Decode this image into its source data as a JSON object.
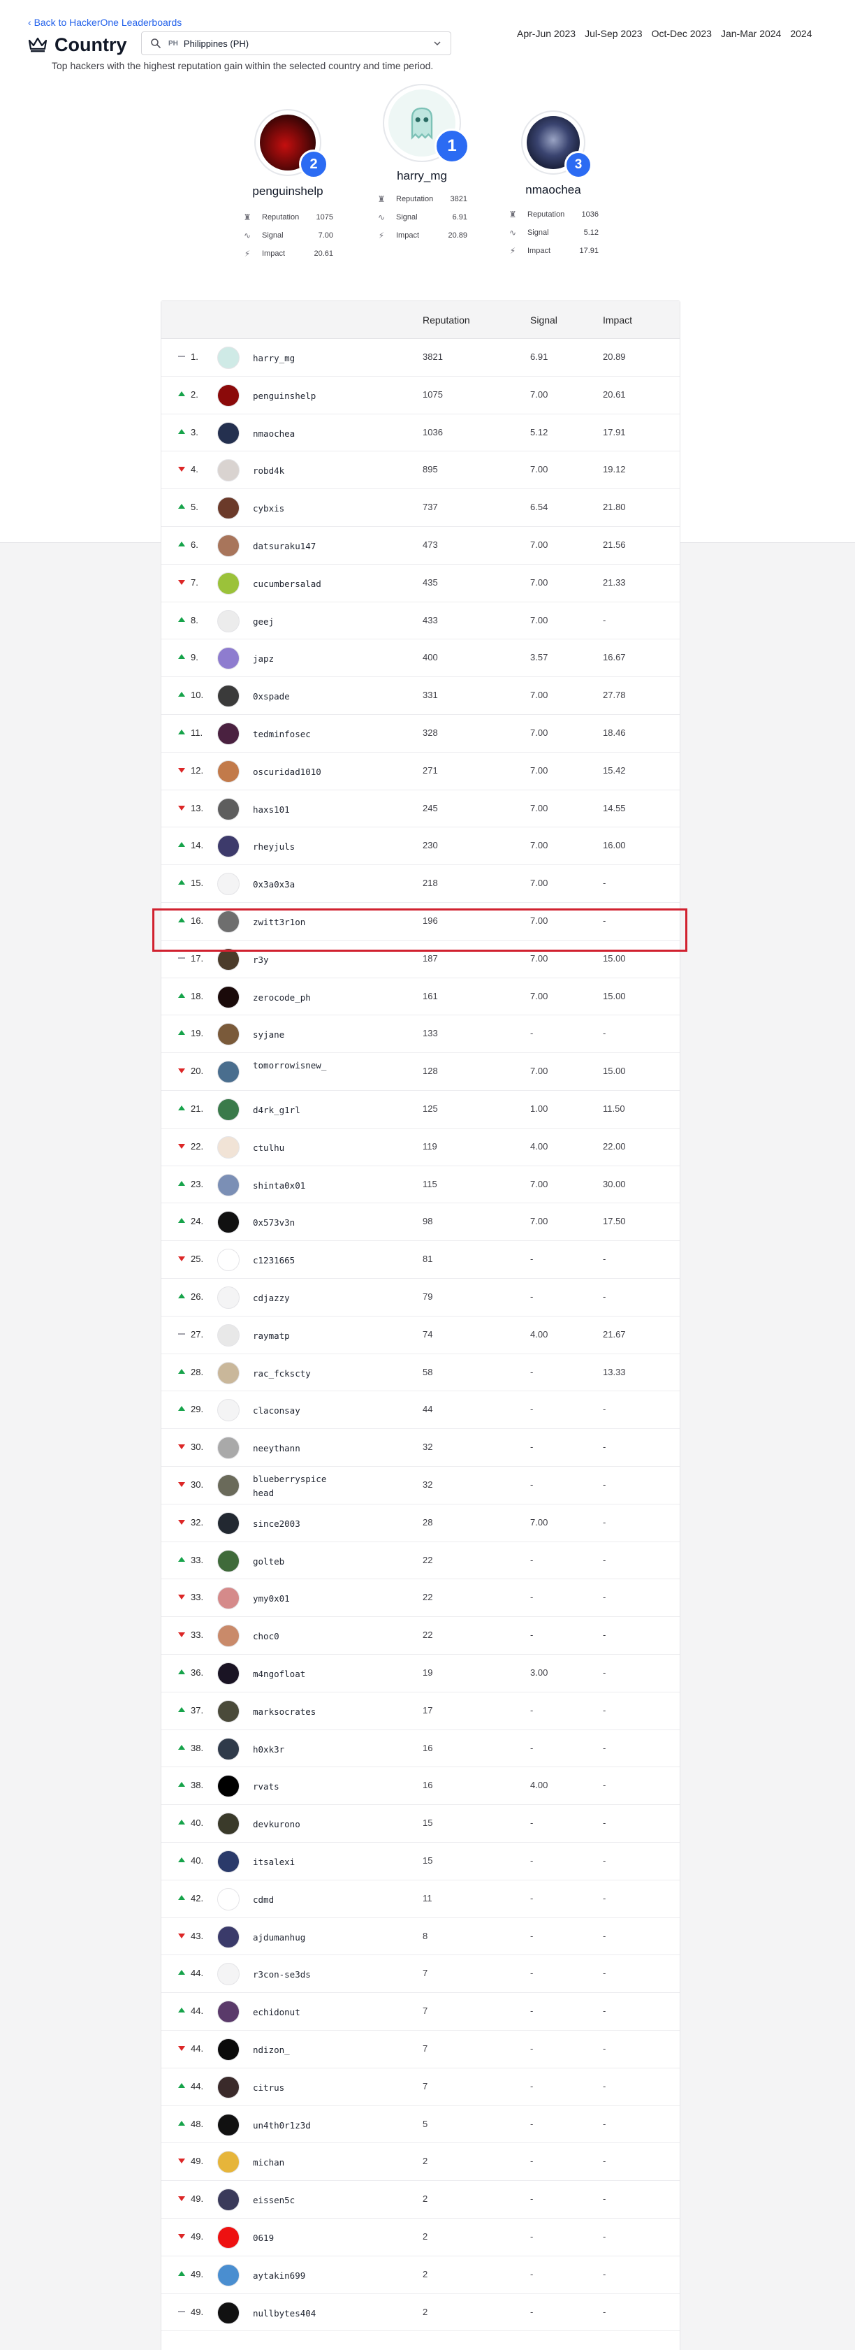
{
  "nav": {
    "back_label": "Back to HackerOne Leaderboards"
  },
  "header": {
    "title": "Country",
    "country_code": "PH",
    "country_value": "Philippines (PH)",
    "subtitle": "Top hackers with the highest reputation gain within the selected country and time period."
  },
  "periods": [
    "Apr-Jun 2023",
    "Jul-Sep 2023",
    "Oct-Dec 2023",
    "Jan-Mar 2024",
    "2024"
  ],
  "podium": [
    {
      "place": "1",
      "name": "harry_mg",
      "reputation": "3821",
      "signal": "6.91",
      "impact": "20.89",
      "avatar_color": "#e8f4f2",
      "avatar_icon": "ghost-icon"
    },
    {
      "place": "2",
      "name": "penguinshelp",
      "reputation": "1075",
      "signal": "7.00",
      "impact": "20.61",
      "avatar_color": "#8b0a0a",
      "avatar_icon": "red-dark-avatar"
    },
    {
      "place": "3",
      "name": "nmaochea",
      "reputation": "1036",
      "signal": "5.12",
      "impact": "17.91",
      "avatar_color": "#1e2a48",
      "avatar_icon": "masked-figure-avatar"
    }
  ],
  "stat_labels": {
    "reputation": "Reputation",
    "signal": "Signal",
    "impact": "Impact"
  },
  "table": {
    "headers": {
      "reputation": "Reputation",
      "signal": "Signal",
      "impact": "Impact"
    },
    "rows": [
      {
        "trend": "same",
        "rank": "1.",
        "name": "harry_mg",
        "rep": "3821",
        "sig": "6.91",
        "imp": "20.89",
        "color": "#cfeae6"
      },
      {
        "trend": "up",
        "rank": "2.",
        "name": "penguinshelp",
        "rep": "1075",
        "sig": "7.00",
        "imp": "20.61",
        "color": "#8b0a0a"
      },
      {
        "trend": "up",
        "rank": "3.",
        "name": "nmaochea",
        "rep": "1036",
        "sig": "5.12",
        "imp": "17.91",
        "color": "#24304f"
      },
      {
        "trend": "down",
        "rank": "4.",
        "name": "robd4k",
        "rep": "895",
        "sig": "7.00",
        "imp": "19.12",
        "color": "#d9d3d0"
      },
      {
        "trend": "up",
        "rank": "5.",
        "name": "cybxis",
        "rep": "737",
        "sig": "6.54",
        "imp": "21.80",
        "color": "#6b3a2a"
      },
      {
        "trend": "up",
        "rank": "6.",
        "name": "datsuraku147",
        "rep": "473",
        "sig": "7.00",
        "imp": "21.56",
        "color": "#a8755b"
      },
      {
        "trend": "down",
        "rank": "7.",
        "name": "cucumbersalad",
        "rep": "435",
        "sig": "7.00",
        "imp": "21.33",
        "color": "#9bc23a"
      },
      {
        "trend": "up",
        "rank": "8.",
        "name": "geej",
        "rep": "433",
        "sig": "7.00",
        "imp": "-",
        "color": "#ececec"
      },
      {
        "trend": "up",
        "rank": "9.",
        "name": "japz",
        "rep": "400",
        "sig": "3.57",
        "imp": "16.67",
        "color": "#8e7ccf"
      },
      {
        "trend": "up",
        "rank": "10.",
        "name": "0xspade",
        "rep": "331",
        "sig": "7.00",
        "imp": "27.78",
        "color": "#3a3a3a"
      },
      {
        "trend": "up",
        "rank": "11.",
        "name": "tedminfosec",
        "rep": "328",
        "sig": "7.00",
        "imp": "18.46",
        "color": "#4a2140"
      },
      {
        "trend": "down",
        "rank": "12.",
        "name": "oscuridad1010",
        "rep": "271",
        "sig": "7.00",
        "imp": "15.42",
        "color": "#c27a4a"
      },
      {
        "trend": "down",
        "rank": "13.",
        "name": "haxs101",
        "rep": "245",
        "sig": "7.00",
        "imp": "14.55",
        "color": "#5e5e5e"
      },
      {
        "trend": "up",
        "rank": "14.",
        "name": "rheyjuls",
        "rep": "230",
        "sig": "7.00",
        "imp": "16.00",
        "color": "#3d3a6b"
      },
      {
        "trend": "up",
        "rank": "15.",
        "name": "0x3a0x3a",
        "rep": "218",
        "sig": "7.00",
        "imp": "-",
        "color": "#f4f4f5"
      },
      {
        "trend": "up",
        "rank": "16.",
        "name": "zwitt3r1on",
        "rep": "196",
        "sig": "7.00",
        "imp": "-",
        "color": "#6e6e6e"
      },
      {
        "trend": "same",
        "rank": "17.",
        "name": "r3y",
        "rep": "187",
        "sig": "7.00",
        "imp": "15.00",
        "color": "#4b3b2a"
      },
      {
        "trend": "up",
        "rank": "18.",
        "name": "zerocode_ph",
        "rep": "161",
        "sig": "7.00",
        "imp": "15.00",
        "color": "#1a0a0a"
      },
      {
        "trend": "up",
        "rank": "19.",
        "name": "syjane",
        "rep": "133",
        "sig": "-",
        "imp": "-",
        "color": "#7a5a3a"
      },
      {
        "trend": "down",
        "rank": "20.",
        "name": "tomorrowisnew_",
        "rep": "128",
        "sig": "7.00",
        "imp": "15.00",
        "color": "#4a6e8e"
      },
      {
        "trend": "up",
        "rank": "21.",
        "name": "d4rk_g1rl",
        "rep": "125",
        "sig": "1.00",
        "imp": "11.50",
        "color": "#3a7a4a"
      },
      {
        "trend": "down",
        "rank": "22.",
        "name": "ctulhu",
        "rep": "119",
        "sig": "4.00",
        "imp": "22.00",
        "color": "#f1e3d6"
      },
      {
        "trend": "up",
        "rank": "23.",
        "name": "shinta0x01",
        "rep": "115",
        "sig": "7.00",
        "imp": "30.00",
        "color": "#7b8fb5"
      },
      {
        "trend": "up",
        "rank": "24.",
        "name": "0x573v3n",
        "rep": "98",
        "sig": "7.00",
        "imp": "17.50",
        "color": "#111111"
      },
      {
        "trend": "down",
        "rank": "25.",
        "name": "c1231665",
        "rep": "81",
        "sig": "-",
        "imp": "-",
        "color": "#ffffff"
      },
      {
        "trend": "up",
        "rank": "26.",
        "name": "cdjazzy",
        "rep": "79",
        "sig": "-",
        "imp": "-",
        "color": "#f4f4f5"
      },
      {
        "trend": "same",
        "rank": "27.",
        "name": "raymatp",
        "rep": "74",
        "sig": "4.00",
        "imp": "21.67",
        "color": "#e8e8e8"
      },
      {
        "trend": "up",
        "rank": "28.",
        "name": "rac_fckscty",
        "rep": "58",
        "sig": "-",
        "imp": "13.33",
        "color": "#c9b79a"
      },
      {
        "trend": "up",
        "rank": "29.",
        "name": "claconsay",
        "rep": "44",
        "sig": "-",
        "imp": "-",
        "color": "#f4f4f5"
      },
      {
        "trend": "down",
        "rank": "30.",
        "name": "neeythann",
        "rep": "32",
        "sig": "-",
        "imp": "-",
        "color": "#a9a9a9"
      },
      {
        "trend": "down",
        "rank": "30.",
        "name": "blueberryspicehead",
        "rep": "32",
        "sig": "-",
        "imp": "-",
        "color": "#6a6a5a"
      },
      {
        "trend": "down",
        "rank": "32.",
        "name": "since2003",
        "rep": "28",
        "sig": "7.00",
        "imp": "-",
        "color": "#222831"
      },
      {
        "trend": "up",
        "rank": "33.",
        "name": "golteb",
        "rep": "22",
        "sig": "-",
        "imp": "-",
        "color": "#3f6a3a"
      },
      {
        "trend": "down",
        "rank": "33.",
        "name": "ymy0x01",
        "rep": "22",
        "sig": "-",
        "imp": "-",
        "color": "#d58a8a"
      },
      {
        "trend": "down",
        "rank": "33.",
        "name": "choc0",
        "rep": "22",
        "sig": "-",
        "imp": "-",
        "color": "#c98a6a"
      },
      {
        "trend": "up",
        "rank": "36.",
        "name": "m4ngofloat",
        "rep": "19",
        "sig": "3.00",
        "imp": "-",
        "color": "#1a1424"
      },
      {
        "trend": "up",
        "rank": "37.",
        "name": "marksocrates",
        "rep": "17",
        "sig": "-",
        "imp": "-",
        "color": "#4a4a3a"
      },
      {
        "trend": "up",
        "rank": "38.",
        "name": "h0xk3r",
        "rep": "16",
        "sig": "-",
        "imp": "-",
        "color": "#2f3a4a"
      },
      {
        "trend": "up",
        "rank": "38.",
        "name": "rvats",
        "rep": "16",
        "sig": "4.00",
        "imp": "-",
        "color": "#000000"
      },
      {
        "trend": "up",
        "rank": "40.",
        "name": "devkurono",
        "rep": "15",
        "sig": "-",
        "imp": "-",
        "color": "#3a3a2a"
      },
      {
        "trend": "up",
        "rank": "40.",
        "name": "itsalexi",
        "rep": "15",
        "sig": "-",
        "imp": "-",
        "color": "#2a3a6a"
      },
      {
        "trend": "up",
        "rank": "42.",
        "name": "cdmd",
        "rep": "11",
        "sig": "-",
        "imp": "-",
        "color": "#ffffff"
      },
      {
        "trend": "down",
        "rank": "43.",
        "name": "ajdumanhug",
        "rep": "8",
        "sig": "-",
        "imp": "-",
        "color": "#3a3a6a"
      },
      {
        "trend": "up",
        "rank": "44.",
        "name": "r3con-se3ds",
        "rep": "7",
        "sig": "-",
        "imp": "-",
        "color": "#f4f4f5"
      },
      {
        "trend": "up",
        "rank": "44.",
        "name": "echidonut",
        "rep": "7",
        "sig": "-",
        "imp": "-",
        "color": "#5a3a6a"
      },
      {
        "trend": "down",
        "rank": "44.",
        "name": "ndizon_",
        "rep": "7",
        "sig": "-",
        "imp": "-",
        "color": "#0a0a0a"
      },
      {
        "trend": "up",
        "rank": "44.",
        "name": "citrus",
        "rep": "7",
        "sig": "-",
        "imp": "-",
        "color": "#3a2a2a"
      },
      {
        "trend": "up",
        "rank": "48.",
        "name": "un4th0r1z3d",
        "rep": "5",
        "sig": "-",
        "imp": "-",
        "color": "#111111"
      },
      {
        "trend": "down",
        "rank": "49.",
        "name": "michan",
        "rep": "2",
        "sig": "-",
        "imp": "-",
        "color": "#e6b53a"
      },
      {
        "trend": "down",
        "rank": "49.",
        "name": "eissen5c",
        "rep": "2",
        "sig": "-",
        "imp": "-",
        "color": "#3a3a5a"
      },
      {
        "trend": "down",
        "rank": "49.",
        "name": "0619",
        "rep": "2",
        "sig": "-",
        "imp": "-",
        "color": "#ee1111"
      },
      {
        "trend": "up",
        "rank": "49.",
        "name": "aytakin699",
        "rep": "2",
        "sig": "-",
        "imp": "-",
        "color": "#4a8ed0"
      },
      {
        "trend": "same",
        "rank": "49.",
        "name": "nullbytes404",
        "rep": "2",
        "sig": "-",
        "imp": "-",
        "color": "#111111"
      }
    ]
  }
}
